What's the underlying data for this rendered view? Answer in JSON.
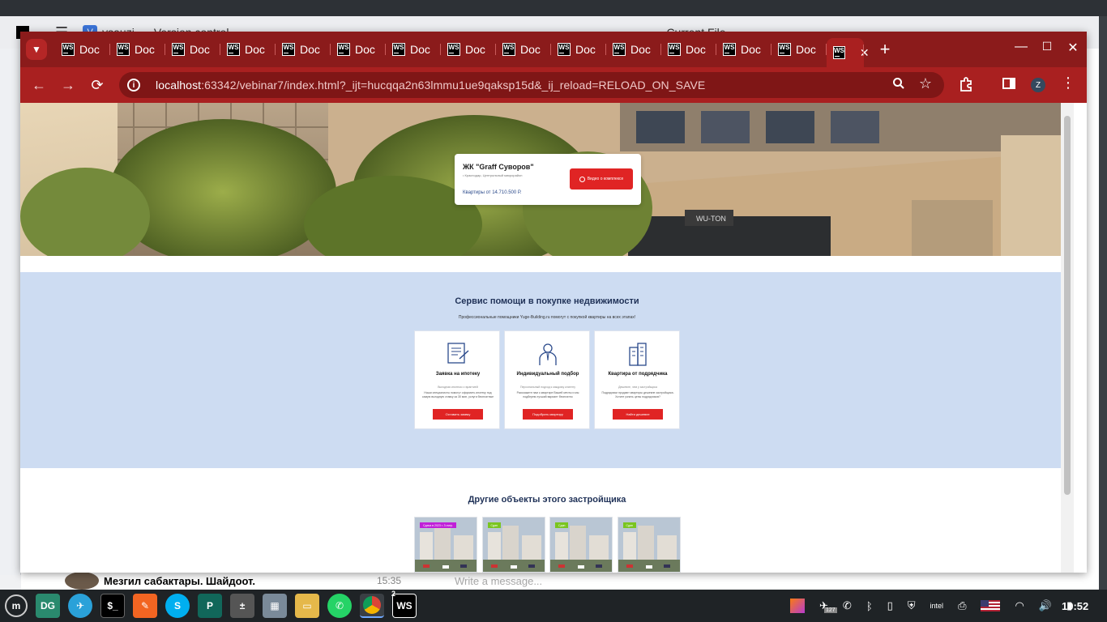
{
  "background_app": {
    "title_left": "Version control",
    "project": "vsauzi",
    "current_file": "Current File",
    "chat_preview": "Мезгил сабактары. Шайдоот.",
    "chat_time": "15:35",
    "message_placeholder": "Write a message..."
  },
  "browser": {
    "tab_label": "Doc",
    "tab_count": 15,
    "url_host": "localhost",
    "url_rest": ":63342/vebinar7/index.html?_ijt=hucqqa2n63lmmu1ue9qaksp15d&_ij_reload=RELOAD_ON_SAVE",
    "profile_initial": "Z",
    "accent": "#a92020"
  },
  "page": {
    "hero": {
      "title": "ЖК \"Graff Суворов\"",
      "location": "• Краснодар, Центральный микрорайон",
      "price": "Квартиры от 14.710.500 Р.",
      "video_button": "Видео о комплексе"
    },
    "service": {
      "title": "Сервис помощи в покупке недвижимости",
      "subtitle": "Профессиональные помощники Yuge-Building.ru помогут с покупкой квартиры на всех этапах!",
      "cards": [
        {
          "title": "Заявка на ипотеку",
          "note": "Выгодная ипотека с гарантией",
          "desc": "Наши специалисты помогут оформить ипотеку под самую выгодную ставку за 30 мин, услуги бесплатные",
          "button": "Оставить заявку"
        },
        {
          "title": "Индивидуальный подбор",
          "note": "Персональный подход к каждому клиенту",
          "desc": "Расскажите нам о квартире Вашей мечты и мы подберем лучший вариант бесплатно",
          "button": "Подобрать квартиру"
        },
        {
          "title": "Квартира от подрядчика",
          "note": "Дешевле, чем у застройщика",
          "desc": "Подрядчики продают квартиры дешевле застройщика. Хотите узнать цены подрядчиков?",
          "button": "Найти дешевле"
        }
      ]
    },
    "others": {
      "title": "Другие объекты этого застройщика",
      "items": [
        {
          "badge": "Сдача в 2023 г. 3 очер.",
          "badge_color": "#c020d8"
        },
        {
          "badge": "Сдан",
          "badge_color": "#7ac520"
        },
        {
          "badge": "Сдан",
          "badge_color": "#7ac520"
        },
        {
          "badge": "Сдан",
          "badge_color": "#7ac520"
        }
      ]
    }
  },
  "taskbar": {
    "badge_count": "2",
    "tray_count": "127",
    "clock": "19:52"
  }
}
